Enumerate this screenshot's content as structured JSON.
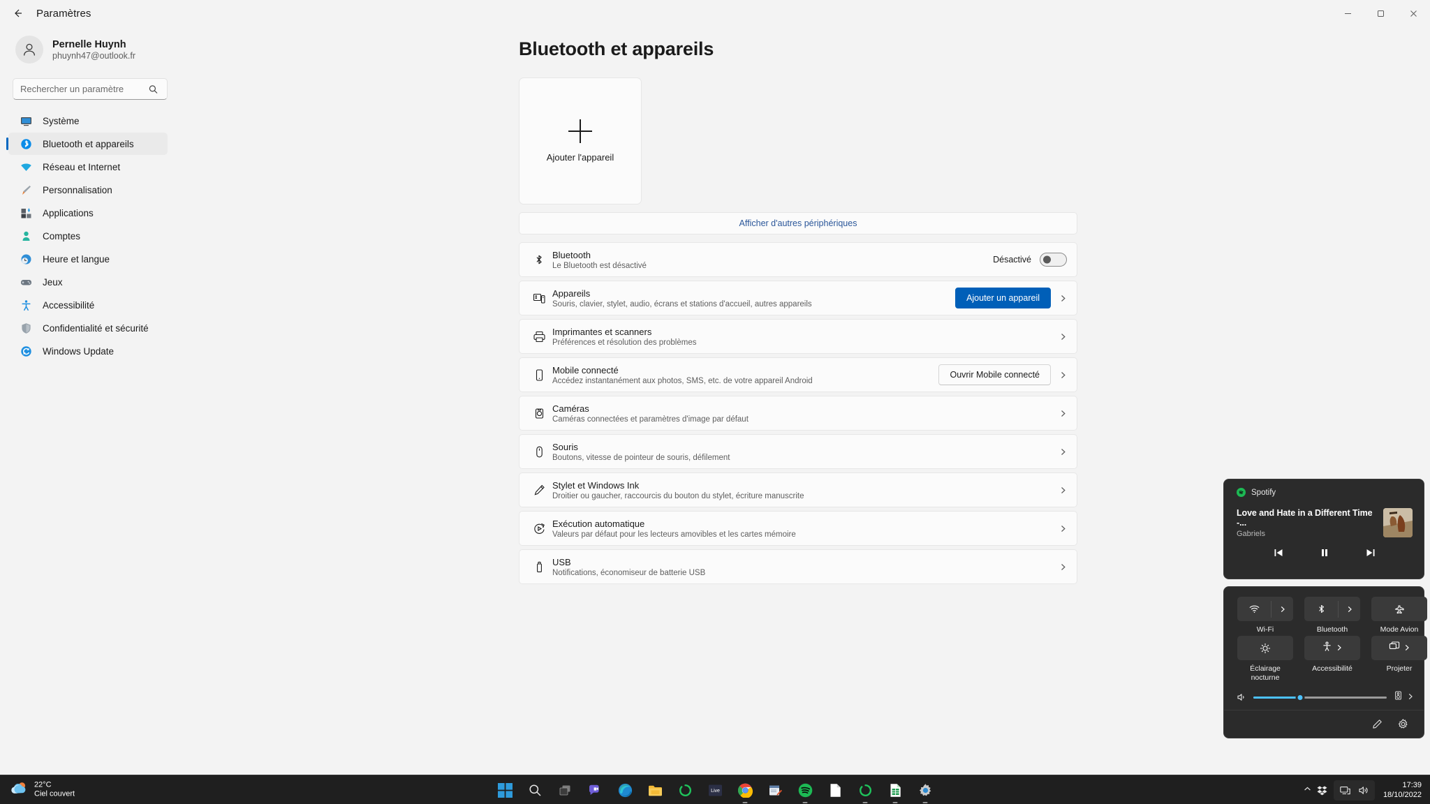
{
  "window": {
    "title": "Paramètres",
    "back_icon": "back-arrow-icon",
    "minimize": "minimize-icon",
    "maximize": "maximize-icon",
    "close": "close-icon"
  },
  "account": {
    "name": "Pernelle Huynh",
    "email": "phuynh47@outlook.fr",
    "avatar_icon": "person-avatar-icon"
  },
  "search": {
    "placeholder": "Rechercher un paramètre",
    "icon": "search-icon"
  },
  "sidebar": {
    "items": [
      {
        "label": "Système",
        "icon": "monitor-icon"
      },
      {
        "label": "Bluetooth et appareils",
        "icon": "bluetooth-icon",
        "active": true
      },
      {
        "label": "Réseau et Internet",
        "icon": "wifi-icon"
      },
      {
        "label": "Personnalisation",
        "icon": "paintbrush-icon"
      },
      {
        "label": "Applications",
        "icon": "apps-icon"
      },
      {
        "label": "Comptes",
        "icon": "account-icon"
      },
      {
        "label": "Heure et langue",
        "icon": "clock-globe-icon"
      },
      {
        "label": "Jeux",
        "icon": "gamepad-icon"
      },
      {
        "label": "Accessibilité",
        "icon": "accessibility-icon"
      },
      {
        "label": "Confidentialité et sécurité",
        "icon": "shield-icon"
      },
      {
        "label": "Windows Update",
        "icon": "update-icon"
      }
    ]
  },
  "main": {
    "title": "Bluetooth et appareils",
    "add_device_card": {
      "label": "Ajouter l'appareil",
      "icon": "plus-icon"
    },
    "show_more_link": "Afficher d'autres périphériques",
    "bluetooth_row": {
      "title": "Bluetooth",
      "subtitle": "Le Bluetooth est désactivé",
      "icon": "bluetooth-icon",
      "toggle_label": "Désactivé",
      "toggle_on": false
    },
    "rows": [
      {
        "title": "Appareils",
        "subtitle": "Souris, clavier, stylet, audio, écrans et stations d'accueil, autres appareils",
        "icon": "devices-icon",
        "button": "Ajouter un appareil",
        "button_style": "primary"
      },
      {
        "title": "Imprimantes et scanners",
        "subtitle": "Préférences et résolution des problèmes",
        "icon": "printer-icon"
      },
      {
        "title": "Mobile connecté",
        "subtitle": "Accédez instantanément aux photos, SMS, etc. de votre appareil Android",
        "icon": "phone-icon",
        "button": "Ouvrir Mobile connecté",
        "button_style": "plain"
      },
      {
        "title": "Caméras",
        "subtitle": "Caméras connectées et paramètres d'image par défaut",
        "icon": "camera-icon"
      },
      {
        "title": "Souris",
        "subtitle": "Boutons, vitesse de pointeur de souris, défilement",
        "icon": "mouse-icon"
      },
      {
        "title": "Stylet et Windows Ink",
        "subtitle": "Droitier ou gaucher, raccourcis du bouton du stylet, écriture manuscrite",
        "icon": "pen-icon"
      },
      {
        "title": "Exécution automatique",
        "subtitle": "Valeurs par défaut pour les lecteurs amovibles et les cartes mémoire",
        "icon": "autoplay-icon"
      },
      {
        "title": "USB",
        "subtitle": "Notifications, économiseur de batterie USB",
        "icon": "usb-icon"
      }
    ]
  },
  "spotify": {
    "app_name": "Spotify",
    "track": "Love and Hate in a Different Time -...",
    "artist": "Gabriels",
    "logo_icon": "spotify-logo-icon",
    "album_art_icon": "album-art",
    "controls": {
      "previous": "previous-track-icon",
      "pause": "pause-icon",
      "next": "next-track-icon"
    }
  },
  "quick_settings": {
    "tiles": [
      {
        "label": "Wi-Fi",
        "icon": "wifi-icon",
        "has_chevron": true,
        "split": true
      },
      {
        "label": "Bluetooth",
        "icon": "bluetooth-icon",
        "has_chevron": true,
        "split": true
      },
      {
        "label": "Mode Avion",
        "icon": "airplane-icon",
        "has_chevron": false,
        "split": false
      },
      {
        "label": "Éclairage nocturne",
        "icon": "night-light-icon",
        "has_chevron": false,
        "split": false
      },
      {
        "label": "Accessibilité",
        "icon": "accessibility-icon",
        "has_chevron": true,
        "split": false
      },
      {
        "label": "Projeter",
        "icon": "project-icon",
        "has_chevron": true,
        "split": false
      }
    ],
    "volume": {
      "icon": "speaker-icon",
      "percent": 35,
      "output_icon": "audio-output-icon",
      "output_chevron": "chevron-right-icon"
    },
    "footer": {
      "edit_icon": "pencil-edit-icon",
      "settings_icon": "gear-icon"
    }
  },
  "taskbar": {
    "weather": {
      "temperature": "22°C",
      "condition": "Ciel couvert",
      "icon": "cloud-icon"
    },
    "apps": [
      {
        "name": "start-button",
        "icon": "windows-logo-icon",
        "running": false
      },
      {
        "name": "search-button",
        "icon": "search-icon",
        "running": false
      },
      {
        "name": "task-view-button",
        "icon": "task-view-icon",
        "running": false
      },
      {
        "name": "chat-button",
        "icon": "chat-icon",
        "running": false
      },
      {
        "name": "microsoft-edge",
        "icon": "edge-icon",
        "running": false
      },
      {
        "name": "file-explorer",
        "icon": "folder-icon",
        "running": false
      },
      {
        "name": "app-green-ring-1",
        "icon": "green-ring-icon",
        "running": false
      },
      {
        "name": "live-app",
        "icon": "live-icon",
        "running": false
      },
      {
        "name": "google-chrome",
        "icon": "chrome-icon",
        "running": true
      },
      {
        "name": "notes-app",
        "icon": "notes-icon",
        "running": false
      },
      {
        "name": "spotify",
        "icon": "spotify-icon",
        "running": true
      },
      {
        "name": "document-app",
        "icon": "document-icon",
        "running": false
      },
      {
        "name": "app-green-ring-2",
        "icon": "green-ring-icon",
        "running": true
      },
      {
        "name": "spreadsheet-app",
        "icon": "spreadsheet-icon",
        "running": true
      },
      {
        "name": "settings-app",
        "icon": "gear-icon",
        "running": true
      }
    ],
    "tray": {
      "chevron": "chevron-up-icon",
      "dropbox_icon": "dropbox-icon",
      "network_icon": "network-icon",
      "volume_icon": "speaker-icon",
      "time": "17:39",
      "date": "18/10/2022"
    }
  }
}
